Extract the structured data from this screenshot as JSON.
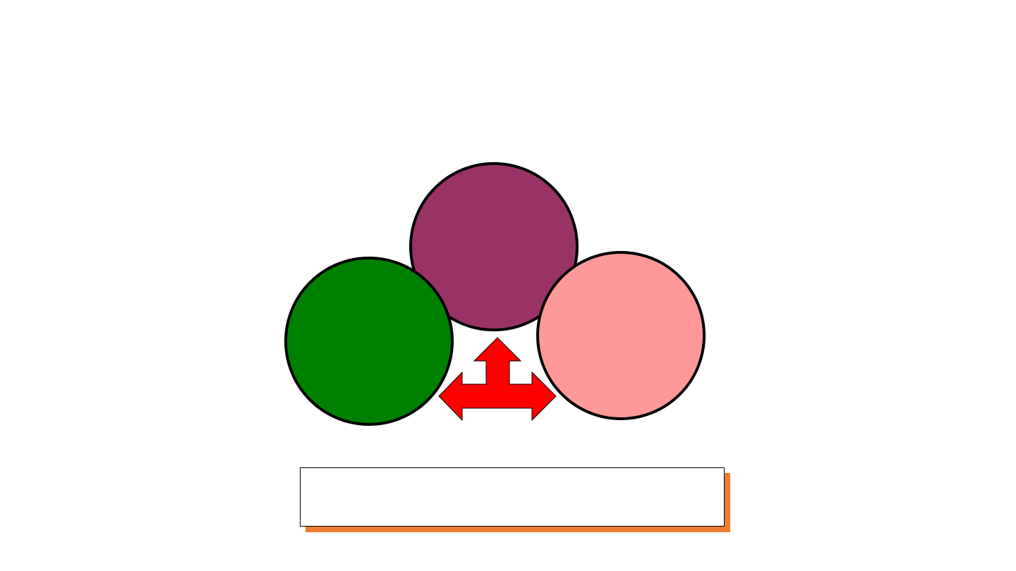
{
  "slide": {
    "background": "#FFFFFF"
  },
  "circles": [
    {
      "id": "top",
      "fill": "#993366"
    },
    {
      "id": "left",
      "fill": "#008000"
    },
    {
      "id": "right",
      "fill": "#FF9999"
    }
  ],
  "arrow": {
    "icon": "three-way-arrow-icon",
    "fill": "#FF0000"
  },
  "caption": {
    "text": "",
    "shadow_color": "#ED7D31"
  }
}
